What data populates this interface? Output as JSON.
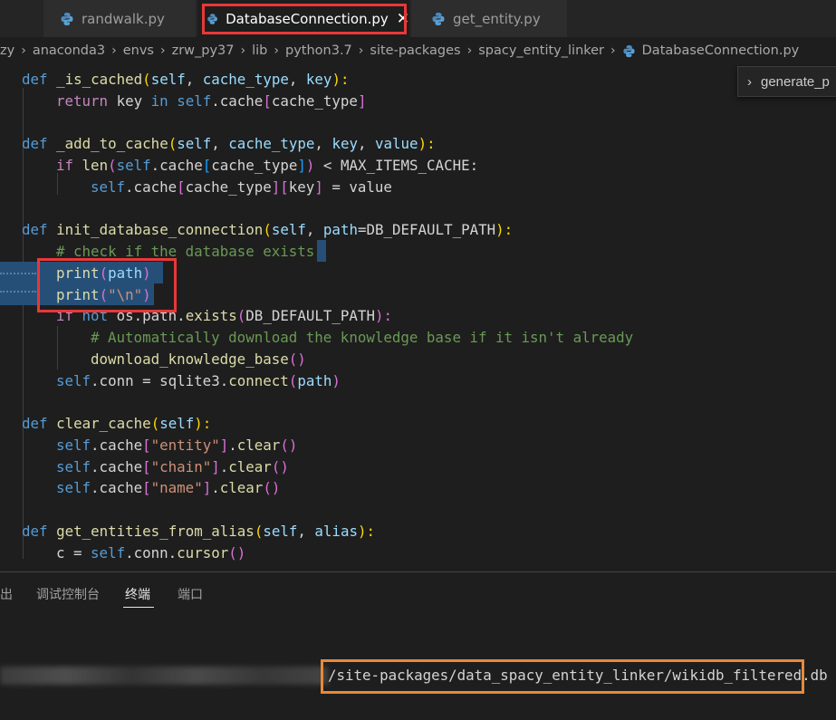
{
  "tabs": [
    {
      "label": "randwalk.py",
      "active": false
    },
    {
      "label": "DatabaseConnection.py",
      "active": true
    },
    {
      "label": "get_entity.py",
      "active": false
    }
  ],
  "tab_close_glyph": "✕",
  "breadcrumb": {
    "items": [
      "zy",
      "anaconda3",
      "envs",
      "zrw_py37",
      "lib",
      "python3.7",
      "site-packages",
      "spacy_entity_linker"
    ],
    "file": "DatabaseConnection.py"
  },
  "outline_widget": {
    "text": "generate_p"
  },
  "code": {
    "l1": {
      "t1": "def",
      "t2": "_is_cached",
      "t3": "(",
      "t4": "self",
      "t5": ", ",
      "t6": "cache_type",
      "t7": ", ",
      "t8": "key",
      "t9": "):"
    },
    "l2": {
      "t1": "return",
      "t2": " key ",
      "t3": "in",
      "t4": " ",
      "t5": "self",
      "t6": ".cache",
      "t7": "[",
      "t8": "cache_type",
      "t9": "]"
    },
    "l3": {
      "t1": "def",
      "t2": "_add_to_cache",
      "t3": "(",
      "t4": "self",
      "t5": ", ",
      "t6": "cache_type",
      "t7": ", ",
      "t8": "key",
      "t9": ", ",
      "t10": "value",
      "t11": "):"
    },
    "l4": {
      "t1": "if",
      "t2": " ",
      "t3": "len",
      "t4": "(",
      "t5": "self",
      "t6": ".cache",
      "t7": "[",
      "t8": "cache_type",
      "t9": "]",
      "t10": ")",
      "t11": " < ",
      "t12": "MAX_ITEMS_CACHE",
      "t13": ":"
    },
    "l5": {
      "t1": "self",
      "t2": ".cache",
      "t3": "[",
      "t4": "cache_type",
      "t5": "]",
      "t6": "[",
      "t7": "key",
      "t8": "]",
      "t9": " = value"
    },
    "l6": {
      "t1": "def",
      "t2": "init_database_connection",
      "t3": "(",
      "t4": "self",
      "t5": ", ",
      "t6": "path",
      "t7": "=",
      "t8": "DB_DEFAULT_PATH",
      "t9": "):"
    },
    "l7": {
      "t1": "# check if the database exists"
    },
    "l8": {
      "t1": "print",
      "t2": "(",
      "t3": "path",
      "t4": ")"
    },
    "l9": {
      "t1": "print",
      "t2": "(",
      "t3": "\"\\n\"",
      "t4": ")"
    },
    "l10": {
      "t1": "if",
      "t2": " ",
      "t3": "not",
      "t4": " os.path.",
      "t5": "exists",
      "t6": "(",
      "t7": "DB_DEFAULT_PATH",
      "t8": "):"
    },
    "l11": {
      "t1": "# Automatically download the knowledge base if it isn't already"
    },
    "l12": {
      "t1": "download_knowledge_base",
      "t2": "()"
    },
    "l13": {
      "t1": "self",
      "t2": ".conn = sqlite3.",
      "t3": "connect",
      "t4": "(",
      "t5": "path",
      "t6": ")"
    },
    "l14": {
      "t1": "def",
      "t2": "clear_cache",
      "t3": "(",
      "t4": "self",
      "t5": "):"
    },
    "l15": {
      "t1": "self",
      "t2": ".cache",
      "t3": "[",
      "t4": "\"entity\"",
      "t5": "]",
      "t6": ".",
      "t7": "clear",
      "t8": "()"
    },
    "l16": {
      "t1": "self",
      "t2": ".cache",
      "t3": "[",
      "t4": "\"chain\"",
      "t5": "]",
      "t6": ".",
      "t7": "clear",
      "t8": "()"
    },
    "l17": {
      "t1": "self",
      "t2": ".cache",
      "t3": "[",
      "t4": "\"name\"",
      "t5": "]",
      "t6": ".",
      "t7": "clear",
      "t8": "()"
    },
    "l18": {
      "t1": "def",
      "t2": "get_entities_from_alias",
      "t3": "(",
      "t4": "self",
      "t5": ", ",
      "t6": "alias",
      "t7": "):"
    },
    "l19": {
      "t1": "c = ",
      "t2": "self",
      "t3": ".conn.",
      "t4": "cursor",
      "t5": "()"
    }
  },
  "panel": {
    "tabs": [
      "出",
      "调试控制台",
      "终端",
      "端口"
    ],
    "active_tab": "终端",
    "terminal_path": "/site-packages/data_spacy_entity_linker/wikidb_filtered.db"
  },
  "colors": {
    "highlight_red": "#e83838",
    "highlight_orange": "#e8893a",
    "keyword": "#569cd6",
    "function": "#dcdcaa",
    "parameter": "#9cdcfe",
    "string": "#ce9178",
    "comment": "#6a9955"
  }
}
